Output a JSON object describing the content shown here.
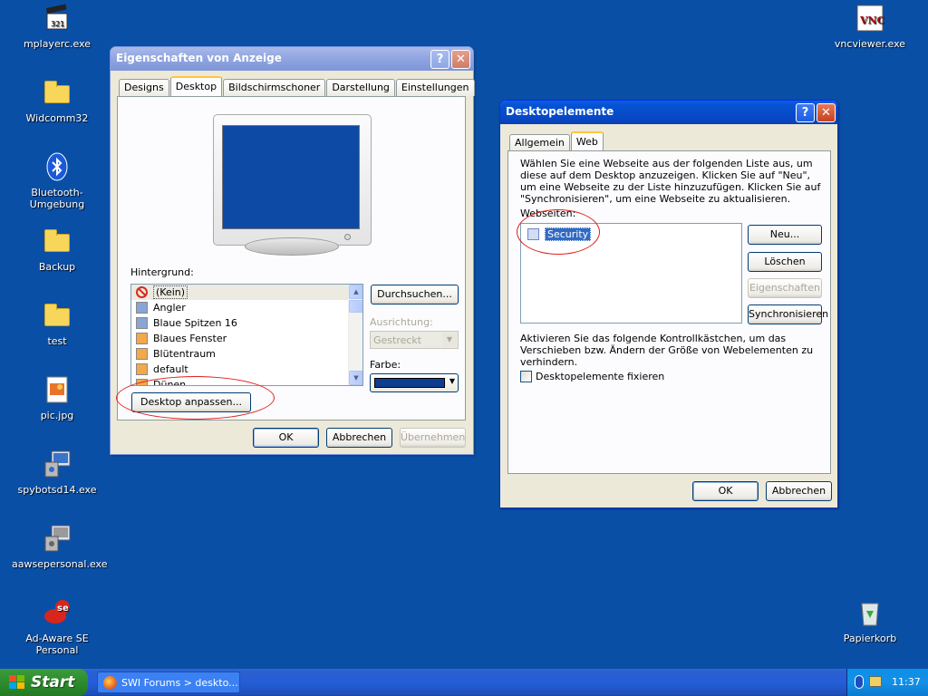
{
  "desktop": {
    "background_color": "#0a4fa6",
    "icons": [
      {
        "label": "mplayerc.exe",
        "icon": "clapperboard-icon"
      },
      {
        "label": "Widcomm32",
        "icon": "folder-icon"
      },
      {
        "label": "Bluetooth-Umgebung",
        "icon": "bluetooth-icon"
      },
      {
        "label": "Backup",
        "icon": "folder-icon"
      },
      {
        "label": "test",
        "icon": "folder-icon"
      },
      {
        "label": "pic.jpg",
        "icon": "image-file-icon"
      },
      {
        "label": "spybotsd14.exe",
        "icon": "installer-icon"
      },
      {
        "label": "aawsepersonal.exe",
        "icon": "installer-icon"
      },
      {
        "label": "Ad-Aware SE Personal",
        "icon": "adaware-icon"
      },
      {
        "label": "vncviewer.exe",
        "icon": "vnc-icon"
      },
      {
        "label": "Papierkorb",
        "icon": "recycle-bin-icon"
      }
    ],
    "vnc_badge": "VNC",
    "se_badge": "se"
  },
  "display_props": {
    "title": "Eigenschaften von Anzeige",
    "tabs": [
      "Designs",
      "Desktop",
      "Bildschirmschoner",
      "Darstellung",
      "Einstellungen"
    ],
    "active_tab": "Desktop",
    "background_label": "Hintergrund:",
    "background_items": [
      "(Kein)",
      "Angler",
      "Blaue Spitzen 16",
      "Blaues Fenster",
      "Blütentraum",
      "default",
      "Dünen"
    ],
    "selected_item": "(Kein)",
    "browse_button": "Durchsuchen...",
    "alignment_label": "Ausrichtung:",
    "alignment_value": "Gestreckt",
    "color_label": "Farbe:",
    "color_value": "#0d3d8f",
    "customize_button": "Desktop anpassen...",
    "ok": "OK",
    "cancel": "Abbrechen",
    "apply": "Übernehmen"
  },
  "desktop_items": {
    "title": "Desktopelemente",
    "tabs": [
      "Allgemein",
      "Web"
    ],
    "active_tab": "Web",
    "description": "Wählen Sie eine Webseite aus der folgenden Liste aus, um diese auf dem Desktop anzuzeigen. Klicken Sie auf \"Neu\", um eine Webseite zu der Liste hinzuzufügen. Klicken Sie auf \"Synchronisieren\", um eine Webseite zu aktualisieren.",
    "webpages_label": "Webseiten:",
    "webpages": [
      {
        "label": "Security",
        "checked": false
      }
    ],
    "new_button": "Neu...",
    "delete_button": "Löschen",
    "properties_button": "Eigenschaften",
    "sync_button": "Synchronisieren",
    "lock_description": "Aktivieren Sie das folgende Kontrollkästchen, um das Verschieben bzw. Ändern der Größe von Webelementen zu verhindern.",
    "lock_checkbox": "Desktopelemente fixieren",
    "ok": "OK",
    "cancel": "Abbrechen"
  },
  "taskbar": {
    "start": "Start",
    "task": "SWI Forums > deskto...",
    "clock": "11:37"
  },
  "colors": {
    "accent": "#0a5de6",
    "annotation": "#e0201b",
    "start_green": "#2d8c2d"
  }
}
